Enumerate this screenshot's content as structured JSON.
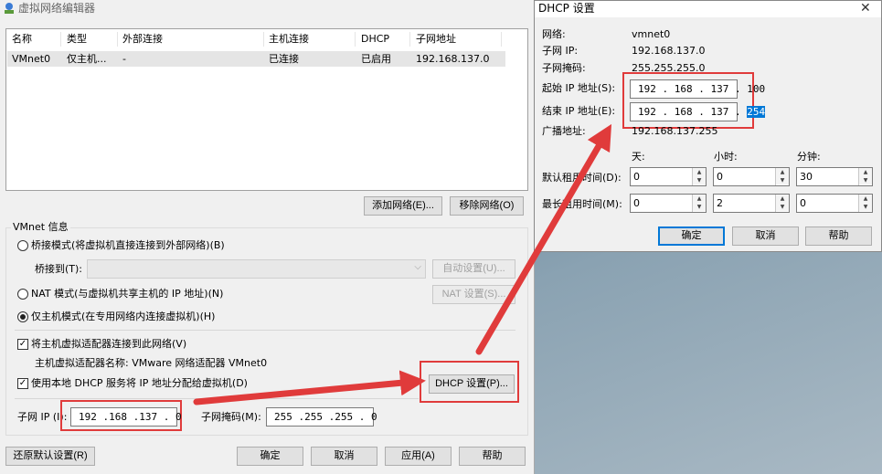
{
  "vne": {
    "title": "虚拟网络编辑器",
    "table": {
      "headers": [
        "名称",
        "类型",
        "外部连接",
        "主机连接",
        "DHCP",
        "子网地址"
      ],
      "rows": [
        [
          "VMnet0",
          "仅主机...",
          "-",
          "已连接",
          "已启用",
          "192.168.137.0"
        ]
      ]
    },
    "add_network": "添加网络(E)...",
    "remove_network": "移除网络(O)",
    "vmnet_info_label": "VMnet 信息",
    "bridge_mode": "桥接模式(将虚拟机直接连接到外部网络)(B)",
    "bridge_to_label": "桥接到(T):",
    "auto_settings": "自动设置(U)...",
    "nat_mode": "NAT 模式(与虚拟机共享主机的 IP 地址)(N)",
    "nat_settings": "NAT 设置(S)...",
    "host_only_mode": "仅主机模式(在专用网络内连接虚拟机)(H)",
    "connect_adapter": "将主机虚拟适配器连接到此网络(V)",
    "adapter_name": "主机虚拟适配器名称: VMware 网络适配器 VMnet0",
    "use_dhcp": "使用本地 DHCP 服务将 IP 地址分配给虚拟机(D)",
    "dhcp_settings": "DHCP 设置(P)...",
    "subnet_ip_label": "子网 IP (I):",
    "subnet_ip_value": "192 .168 .137 . 0",
    "subnet_mask_label": "子网掩码(M):",
    "subnet_mask_value": "255 .255 .255 . 0",
    "restore_defaults": "还原默认设置(R)",
    "ok": "确定",
    "cancel": "取消",
    "apply": "应用(A)",
    "help": "帮助"
  },
  "dhcp": {
    "title": "DHCP 设置",
    "close": "✕",
    "network_label": "网络:",
    "network_value": "vmnet0",
    "subnet_ip_label": "子网 IP:",
    "subnet_ip_value": "192.168.137.0",
    "subnet_mask_label": "子网掩码:",
    "subnet_mask_value": "255.255.255.0",
    "start_ip_label": "起始 IP 地址(S):",
    "start_ip_value": "192 . 168 . 137 . 100",
    "end_ip_label": "结束 IP 地址(E):",
    "end_ip_prefix": "192 . 168 . 137 . ",
    "end_ip_last": "254",
    "broadcast_label": "广播地址:",
    "broadcast_value": "192.168.137.255",
    "col_days": "天:",
    "col_hours": "小时:",
    "col_minutes": "分钟:",
    "default_lease_label": "默认租用时间(D):",
    "default_lease": [
      "0",
      "0",
      "30"
    ],
    "max_lease_label": "最长租用时间(M):",
    "max_lease": [
      "0",
      "2",
      "0"
    ],
    "ok": "确定",
    "cancel": "取消",
    "help": "帮助"
  },
  "colors": {
    "annotation": "#e03b3b",
    "selection": "#0078d7",
    "window_bg": "#f0f0f0"
  }
}
